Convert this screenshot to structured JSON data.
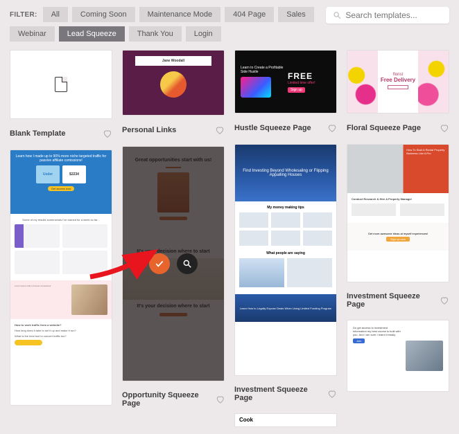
{
  "filter_label": "FILTER:",
  "filters": [
    "All",
    "Coming Soon",
    "Maintenance Mode",
    "404 Page",
    "Sales",
    "Webinar",
    "Lead Squeeze",
    "Thank You",
    "Login"
  ],
  "active_filter": "Lead Squeeze",
  "search": {
    "placeholder": "Search templates..."
  },
  "col1": {
    "blank": "Blank Template",
    "mkt_headline": "Learn how I made up to 90% more niche targeted traffic for passive affiliate comissions!",
    "mkt_card_a": "Usder",
    "mkt_card_b": "$2234",
    "mkt_btn": "Get access now",
    "mkt_charts_t": "Some of my results screenshots I've earned for a week so far..."
  },
  "col2": {
    "personal": "Personal Links",
    "personal_name": "Jane Woodall",
    "opp": "Opportunity Squeeze Page",
    "opp_h1": "Great opportunities start with us!",
    "opp_h2": "It's your decision where to start"
  },
  "col3": {
    "hustle_title": "Hustle Squeeze Page",
    "hustle_line": "Learn to Create a Profitable Side Hustle",
    "hustle_free": "FREE",
    "hustle_sub": "Limited time offer!",
    "hustle_btn": "Sign up",
    "invest_title": "Investment Squeeze Page",
    "invest_hero": "Find Investing Beyond Wholesaling or Flipping Appalling Houses",
    "invest_sec": "My money making tips",
    "invest_sec2": "What people are saying",
    "invest_foot": "Learn How to Legally Expose Deals When Using Limited Funding Program",
    "cook": "Cook"
  },
  "col4": {
    "floral_title": "Floral Squeeze Page",
    "floral_h": "Free Delivery",
    "floral_sub": "florist",
    "inv2_title": "Investment Squeeze Page",
    "inv2_hero": "How To Start A Rental Property Business Like A Pro",
    "inv2_mid": "Conduct Research & Hire A Property Manager",
    "inv2_cta_t": "Get more awesome ideas at myself experiences!",
    "inv2_cta_b": "Sign up now",
    "inv3_btn": "Join"
  }
}
